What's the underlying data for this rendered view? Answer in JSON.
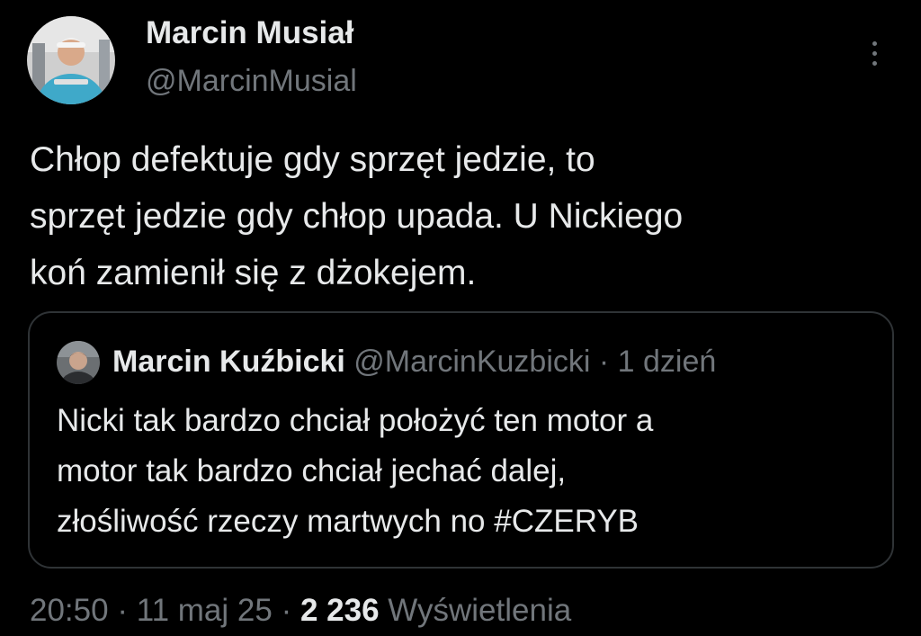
{
  "author": {
    "name": "Marcin Musiał",
    "handle": "@MarcinMusial"
  },
  "tweet": {
    "lines": [
      "Chłop defektuje gdy sprzęt jedzie, to",
      "sprzęt jedzie gdy chłop upada. U Nickiego",
      "koń zamienił się z dżokejem."
    ]
  },
  "quote": {
    "name": "Marcin Kuźbicki",
    "handle": "@MarcinKuzbicki",
    "separator": "·",
    "time": "1 dzień",
    "lines": [
      "Nicki tak bardzo chciał położyć ten motor a",
      "motor tak bardzo chciał jechać dalej,",
      "złośliwość rzeczy martwych no #CZERYB"
    ]
  },
  "meta": {
    "time": "20:50",
    "separator": "·",
    "date": "11 maj 25",
    "views_count": "2 236",
    "views_label": "Wyświetlenia"
  },
  "icons": {
    "more": "more-vertical-icon"
  },
  "colors": {
    "background": "#000000",
    "text_primary": "#e7e9ea",
    "text_secondary": "#71767b",
    "border": "#2f3336"
  }
}
